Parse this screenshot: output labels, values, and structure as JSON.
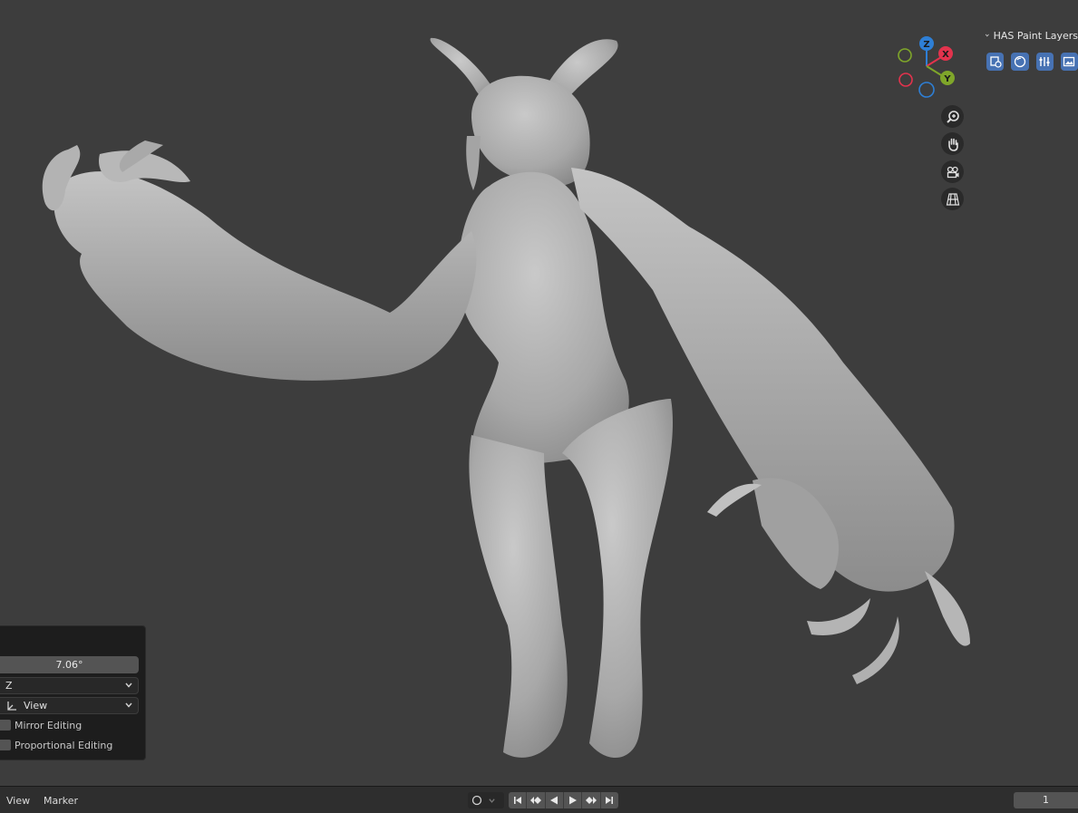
{
  "viewport": {
    "gizmo": {
      "x_label": "X",
      "y_label": "Y",
      "z_label": "Z"
    },
    "nav_icons": [
      "zoom-icon",
      "pan-hand-icon",
      "camera-icon",
      "ortho-grid-icon"
    ]
  },
  "has_panel": {
    "title": "HAS Paint Layers",
    "icons": [
      "layer-add-icon",
      "sphere-icon",
      "tools-icon",
      "image-icon"
    ]
  },
  "operator_panel": {
    "value": "7.06°",
    "axis_select": "Z",
    "orientation_select": "View",
    "mirror_label": "Mirror Editing",
    "proportional_label": "Proportional Editing"
  },
  "timeline": {
    "menu_view": "View",
    "menu_marker": "Marker",
    "current_frame": "1"
  },
  "colors": {
    "viewport_bg": "#3d3d3d",
    "x_axis": "#e3334d",
    "y_axis": "#7fa62a",
    "z_axis": "#2e7fd6",
    "accent": "#4772b3"
  }
}
